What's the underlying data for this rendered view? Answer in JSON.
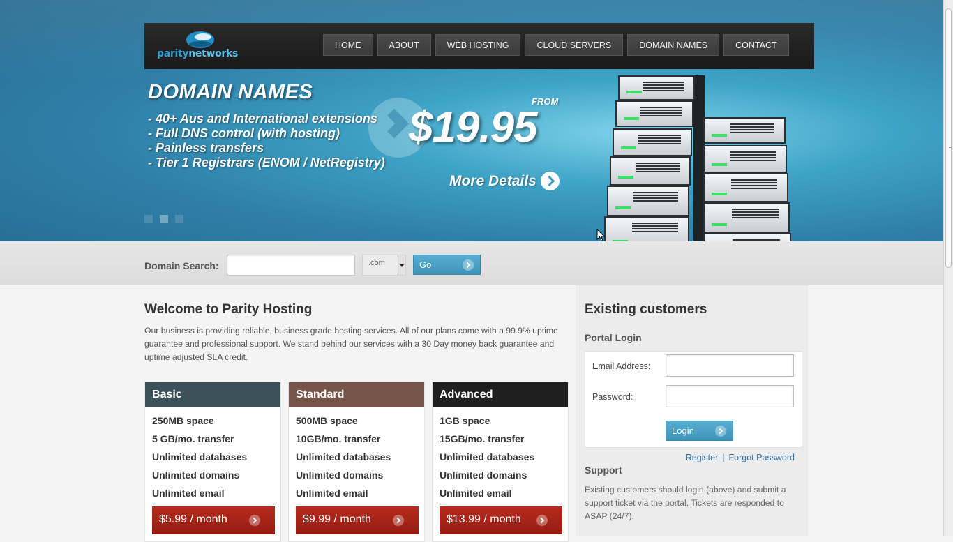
{
  "brand": {
    "logo_part1": "parity",
    "logo_part2": "networks"
  },
  "nav": {
    "items": [
      {
        "label": "HOME"
      },
      {
        "label": "ABOUT"
      },
      {
        "label": "WEB HOSTING"
      },
      {
        "label": "CLOUD SERVERS"
      },
      {
        "label": "DOMAIN NAMES"
      },
      {
        "label": "CONTACT"
      }
    ]
  },
  "hero": {
    "title": "DOMAIN NAMES",
    "bullets": [
      "- 40+ Aus and International extensions",
      "- Full DNS control (with hosting)",
      "- Painless transfers",
      "- Tier 1 Registrars (ENOM / NetRegistry)"
    ],
    "from_label": "FROM",
    "price": "$19.95",
    "more_details": "More Details",
    "slides_total": 3,
    "active_slide": 2
  },
  "domain_search": {
    "label": "Domain Search:",
    "input_value": "",
    "tld_selected": ".com",
    "go_label": "Go"
  },
  "welcome": {
    "title": "Welcome to Parity Hosting",
    "text": "Our business is providing reliable, business grade hosting services. All of our plans come with a 99.9% uptime guarantee and professional support. We stand behind our services with a 30 Day money back guarantee and uptime adjusted SLA credit."
  },
  "plans": [
    {
      "name": "Basic",
      "color": "#3a5257",
      "features": [
        "250MB space",
        "5 GB/mo. transfer",
        "Unlimited databases",
        "Unlimited domains",
        "Unlimited email"
      ],
      "price": "$5.99 / month"
    },
    {
      "name": "Standard",
      "color": "#76544a",
      "features": [
        "500MB space",
        "10GB/mo. transfer",
        "Unlimited databases",
        "Unlimited domains",
        "Unlimited email"
      ],
      "price": "$9.99 / month"
    },
    {
      "name": "Advanced",
      "color": "#1f1f1f",
      "features": [
        "1GB space",
        "15GB/mo. transfer",
        "Unlimited databases",
        "Unlimited domains",
        "Unlimited email"
      ],
      "price": "$13.99 / month"
    }
  ],
  "sidebar": {
    "title": "Existing customers",
    "portal_title": "Portal Login",
    "email_label": "Email Address:",
    "password_label": "Password:",
    "login_label": "Login",
    "register_label": "Register",
    "separator": "|",
    "forgot_label": "Forgot Password",
    "support_title": "Support",
    "support_text": "Existing customers should login (above) and submit a support ticket via the portal, Tickets are responded to ASAP (24/7)."
  },
  "colors": {
    "accent_blue": "#3d94b9",
    "price_button_red": "#a5231a",
    "link_blue": "#2f6ea0"
  }
}
